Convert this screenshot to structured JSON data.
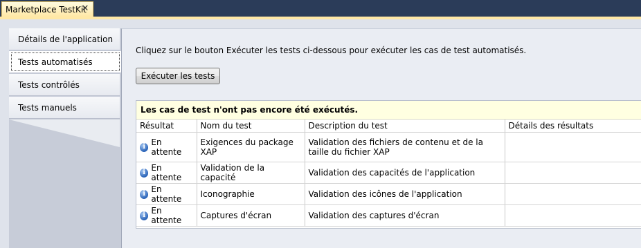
{
  "document_tab": {
    "title": "Marketplace TestKit",
    "close_glyph": "✕"
  },
  "nav": {
    "items": [
      {
        "label": "Détails de l'application"
      },
      {
        "label": "Tests automatisés"
      },
      {
        "label": "Tests contrôlés"
      },
      {
        "label": "Tests manuels"
      }
    ],
    "selected_index": 1
  },
  "main": {
    "instruction": "Cliquez sur le bouton Exécuter les tests ci-dessous pour exécuter les cas de test automatisés.",
    "run_button_label": "Exécuter les tests",
    "banner": "Les cas de test n'ont pas encore été exécutés.",
    "columns": [
      "Résultat",
      "Nom du test",
      "Description du test",
      "Détails des résultats"
    ],
    "rows": [
      {
        "status": "En attente",
        "status_icon": "info-icon",
        "name": "Exigences du package XAP",
        "description": "Validation des fichiers de contenu et de la taille du fichier XAP",
        "details": ""
      },
      {
        "status": "En attente",
        "status_icon": "info-icon",
        "name": "Validation de la capacité",
        "description": "Validation des capacités de l'application",
        "details": ""
      },
      {
        "status": "En attente",
        "status_icon": "info-icon",
        "name": "Iconographie",
        "description": "Validation des icônes de l'application",
        "details": ""
      },
      {
        "status": "En attente",
        "status_icon": "info-icon",
        "name": "Captures d'écran",
        "description": "Validation des captures d'écran",
        "details": ""
      }
    ]
  },
  "colors": {
    "chrome_dark": "#2b3c59",
    "tab_active": "#ffe8a6",
    "banner_bg": "#ffffe1",
    "panel_bg": "#eaedf3"
  }
}
